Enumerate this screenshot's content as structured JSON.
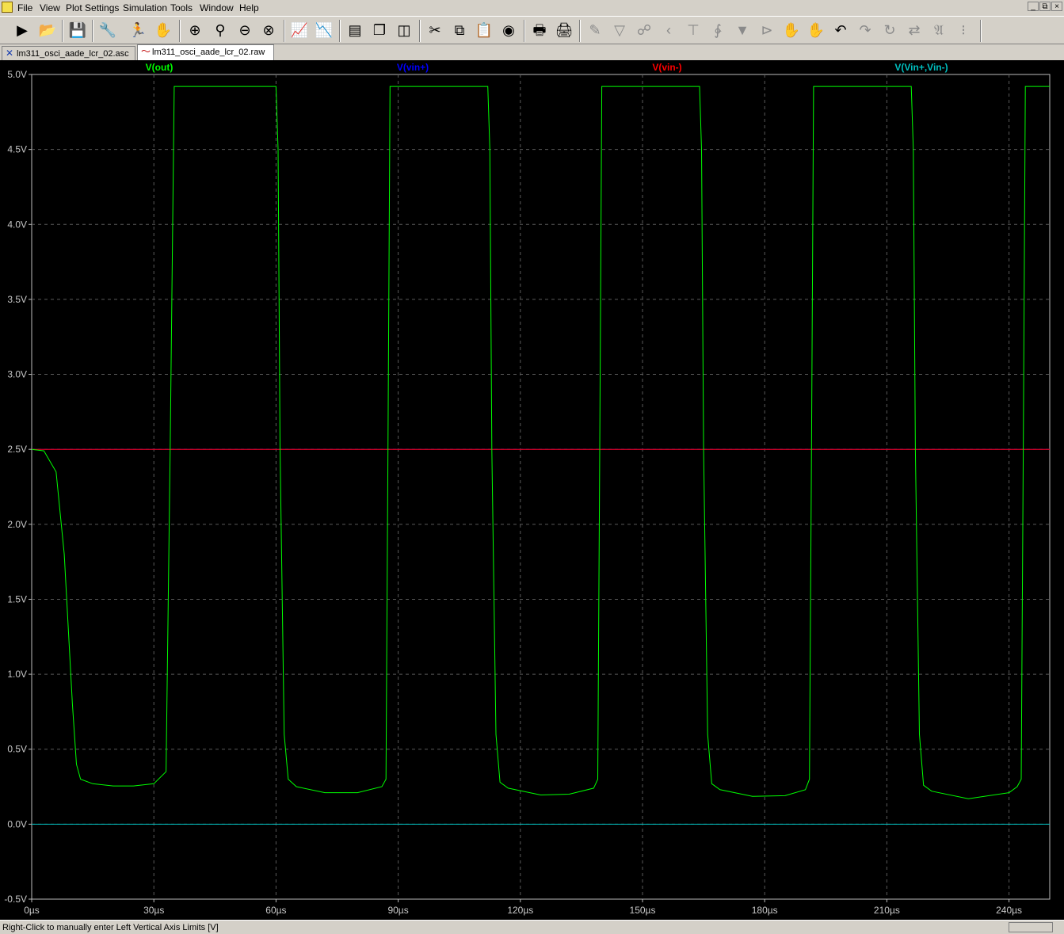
{
  "menu": {
    "items": [
      "File",
      "View",
      "Plot Settings",
      "Simulation",
      "Tools",
      "Window",
      "Help"
    ]
  },
  "window_controls": [
    "_",
    "⧉",
    "×"
  ],
  "toolbar": {
    "icons": [
      "run-icon",
      "open-icon",
      "save-icon",
      "control-panel-icon",
      "halt-icon",
      "pan-hand-icon",
      "zoom-in-icon",
      "zoom-area-icon",
      "zoom-out-icon",
      "zoom-cancel-icon",
      "autorange-icon",
      "fft-icon",
      "tile-horizontal-icon",
      "cascade-icon",
      "tile-vertical-icon",
      "cut-icon",
      "copy-icon",
      "paste-icon",
      "find-icon",
      "print-preview-icon",
      "print-icon",
      "wire-icon",
      "ground-icon",
      "label-icon",
      "resistor-icon",
      "capacitor-icon",
      "inductor-icon",
      "diode-icon",
      "component-icon",
      "move-icon",
      "drag-icon",
      "undo-icon",
      "redo-icon",
      "rotate-icon",
      "mirror-icon",
      "text-icon",
      "spice-directive-icon"
    ]
  },
  "tabs": [
    {
      "label": "lm311_osci_aade_lcr_02.asc",
      "active": false,
      "icon": "schematic-icon"
    },
    {
      "label": "lm311_osci_aade_lcr_02.raw",
      "active": true,
      "icon": "waveform-icon"
    }
  ],
  "status": {
    "text": "Right-Click to manually enter Left Vertical Axis Limits [V]"
  },
  "chart_data": {
    "type": "line",
    "xlabel": "",
    "ylabel": "",
    "xlim": [
      0,
      250
    ],
    "ylim": [
      -0.5,
      5.0
    ],
    "x_ticks": [
      0,
      30,
      60,
      90,
      120,
      150,
      180,
      210,
      240
    ],
    "x_tick_labels": [
      "0µs",
      "30µs",
      "60µs",
      "90µs",
      "120µs",
      "150µs",
      "180µs",
      "210µs",
      "240µs"
    ],
    "y_ticks": [
      -0.5,
      0.0,
      0.5,
      1.0,
      1.5,
      2.0,
      2.5,
      3.0,
      3.5,
      4.0,
      4.5,
      5.0
    ],
    "y_tick_labels": [
      "-0.5V",
      "0.0V",
      "0.5V",
      "1.0V",
      "1.5V",
      "2.0V",
      "2.5V",
      "3.0V",
      "3.5V",
      "4.0V",
      "4.5V",
      "5.0V"
    ],
    "grid": true,
    "background": "#000000",
    "grid_color": "#5a5a5a",
    "series": [
      {
        "name": "V(out)",
        "color": "#00ff00",
        "x": [
          0,
          3,
          6,
          8,
          10,
          11,
          12,
          15,
          20,
          25,
          30,
          33,
          34,
          35,
          36,
          60,
          60.5,
          61,
          62,
          63,
          65,
          72,
          80,
          86,
          87,
          87.5,
          88,
          112,
          112.5,
          113,
          114,
          115,
          117,
          125,
          132,
          138,
          139,
          139.5,
          140,
          164,
          164.5,
          165,
          166,
          167,
          169,
          177,
          185,
          190,
          191,
          191.5,
          192,
          216,
          216.5,
          217,
          218,
          219,
          221,
          230,
          240,
          242,
          243,
          243.5,
          244,
          250
        ],
        "y": [
          2.5,
          2.49,
          2.35,
          1.8,
          0.8,
          0.4,
          0.3,
          0.27,
          0.255,
          0.255,
          0.27,
          0.35,
          2.5,
          4.92,
          4.92,
          4.92,
          4.5,
          2.5,
          0.6,
          0.3,
          0.25,
          0.21,
          0.21,
          0.25,
          0.3,
          2.5,
          4.92,
          4.92,
          4.5,
          2.5,
          0.6,
          0.28,
          0.24,
          0.195,
          0.2,
          0.24,
          0.3,
          2.5,
          4.92,
          4.92,
          4.5,
          2.5,
          0.6,
          0.27,
          0.23,
          0.185,
          0.19,
          0.23,
          0.3,
          2.5,
          4.92,
          4.92,
          4.5,
          2.5,
          0.6,
          0.26,
          0.22,
          0.17,
          0.21,
          0.25,
          0.3,
          2.5,
          4.92,
          4.92
        ]
      },
      {
        "name": "V(vin+)",
        "color": "#0000ff",
        "x": [
          0,
          250
        ],
        "y": [
          2.5,
          2.5
        ]
      },
      {
        "name": "V(vin-)",
        "color": "#ff0000",
        "x": [
          0,
          250
        ],
        "y": [
          2.5,
          2.5
        ]
      },
      {
        "name": "V(Vin+,Vin-)",
        "color": "#00c0c0",
        "x": [
          0,
          250
        ],
        "y": [
          0.0,
          0.0
        ]
      }
    ]
  }
}
